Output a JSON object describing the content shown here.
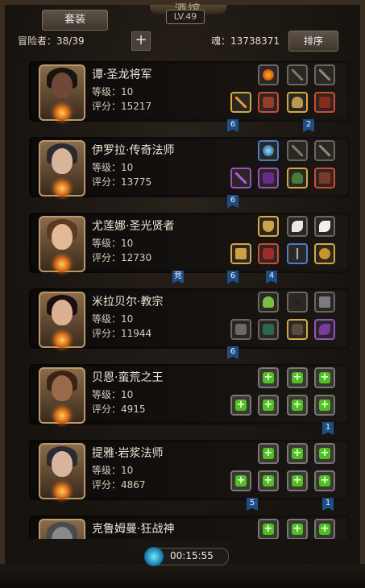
{
  "header": {
    "title": "酒馆",
    "level": "LV.49",
    "tab_label": "套装",
    "adventurer_label": "冒险者：38/39",
    "plus": "+",
    "soul_label": "魂：13738371",
    "sort_label": "排序"
  },
  "heroes": [
    {
      "name": "谭·圣龙将军",
      "level": "等级：10",
      "score": "评分：15217"
    },
    {
      "name": "伊罗拉·传奇法师",
      "level": "等级：10",
      "score": "评分：13775"
    },
    {
      "name": "尤莲娜·圣光贤者",
      "level": "等级：10",
      "score": "评分：12730"
    },
    {
      "name": "米拉贝尔·教宗",
      "level": "等级：10",
      "score": "评分：11944"
    },
    {
      "name": "贝恩·蛮荒之王",
      "level": "等级：10",
      "score": "评分：4915"
    },
    {
      "name": "提雅·岩浆法师",
      "level": "等级：10",
      "score": "评分：4867"
    },
    {
      "name": "克鲁姆曼·狂战神",
      "level": "",
      "score": ""
    }
  ],
  "flags": {
    "f1": "6",
    "f2": "2",
    "f3": "6",
    "f4": "竞",
    "f5": "6",
    "f6": "4",
    "f7": "6",
    "f8": "1",
    "f9": "5",
    "f10": "1"
  },
  "timer": "00:15:55",
  "colors": {
    "accent_gold": "#d6a83e",
    "flag_blue": "#1d4f86",
    "plus_green": "#4fc11e"
  }
}
